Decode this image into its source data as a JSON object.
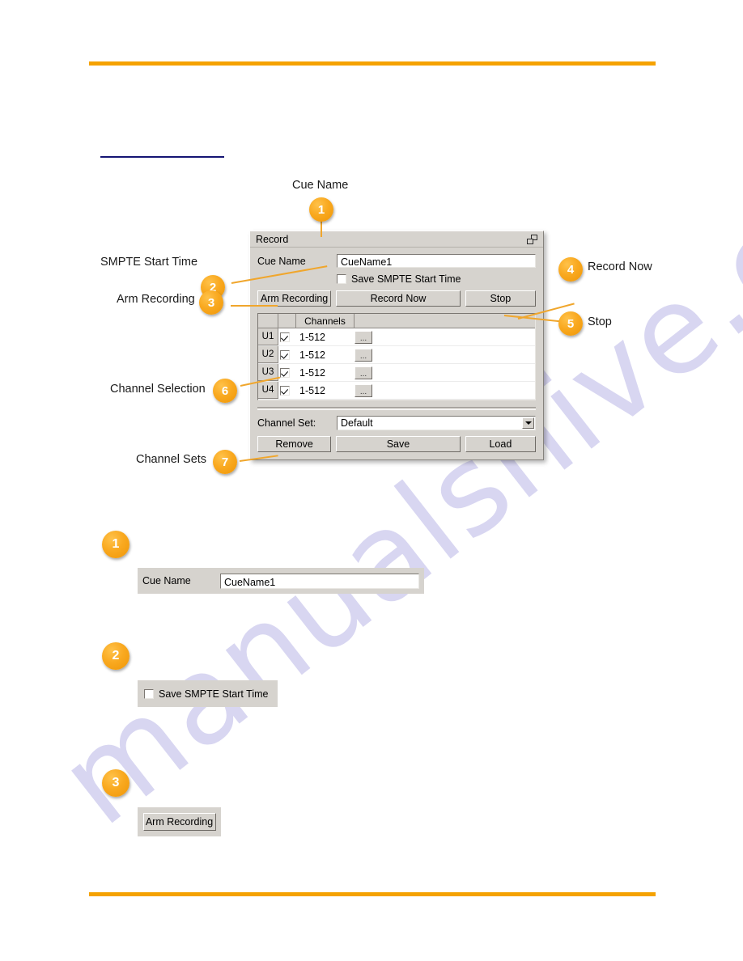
{
  "page": {
    "rule_color": "#f5a200",
    "link_rule_color": "#151573",
    "watermark_text": "manualshive.com"
  },
  "dialog": {
    "title": "Record",
    "restore_icon": "restore-window-icon",
    "cue_name_label": "Cue Name",
    "cue_name_value": "CueName1",
    "smpte_checkbox_label": "Save SMPTE Start Time",
    "smpte_checked": false,
    "buttons": {
      "arm_recording": "Arm Recording",
      "record_now": "Record Now",
      "stop": "Stop"
    },
    "grid": {
      "headers": [
        "",
        "",
        "Channels",
        ""
      ],
      "rows": [
        {
          "unit": "U1",
          "checked": true,
          "channels": "1-512",
          "more": "..."
        },
        {
          "unit": "U2",
          "checked": true,
          "channels": "1-512",
          "more": "..."
        },
        {
          "unit": "U3",
          "checked": true,
          "channels": "1-512",
          "more": "..."
        },
        {
          "unit": "U4",
          "checked": true,
          "channels": "1-512",
          "more": "..."
        }
      ]
    },
    "channel_set_label": "Channel Set:",
    "channel_set_value": "Default",
    "channel_set_options": [
      "Default"
    ],
    "bottom_buttons": {
      "remove": "Remove",
      "save": "Save",
      "load": "Load"
    }
  },
  "callouts": [
    {
      "number": "1",
      "label": "Cue Name"
    },
    {
      "number": "2",
      "label": "SMPTE Start Time"
    },
    {
      "number": "3",
      "label": "Arm Recording"
    },
    {
      "number": "4",
      "label": "Record Now"
    },
    {
      "number": "5",
      "label": "Stop"
    },
    {
      "number": "6",
      "label": "Channel Selection"
    },
    {
      "number": "7",
      "label": "Channel Sets"
    }
  ],
  "details": [
    {
      "number": "1",
      "kind": "cue-name-field",
      "label": "Cue Name",
      "value": "CueName1"
    },
    {
      "number": "2",
      "kind": "smpte-checkbox",
      "label": "Save SMPTE Start Time",
      "checked": false
    },
    {
      "number": "3",
      "kind": "arm-recording-button",
      "label": "Arm Recording"
    }
  ]
}
